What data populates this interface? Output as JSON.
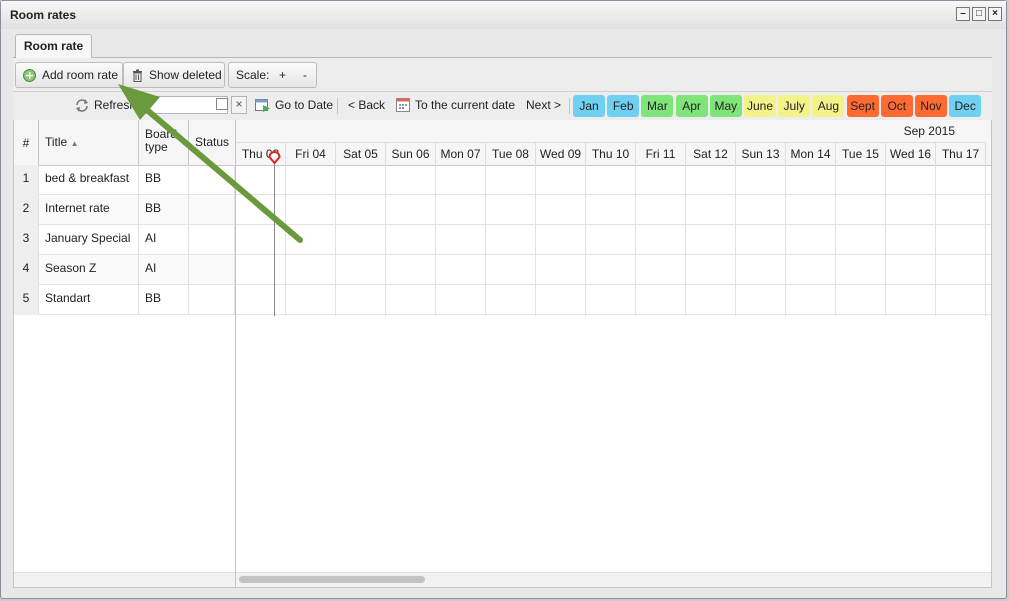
{
  "window": {
    "title": "Room rates"
  },
  "tabs": [
    {
      "label": "Room rate"
    }
  ],
  "toolbar": {
    "add_label": "Add room rate",
    "show_deleted_label": "Show deleted",
    "scale_label": "Scale:",
    "scale_plus": "+",
    "scale_minus": "-"
  },
  "nav": {
    "refresh_label": "Refresh",
    "date_value": "",
    "go_to_date_label": "Go to Date",
    "back_label": "< Back",
    "current_date_label": "To the current date",
    "next_label": "Next >"
  },
  "months": [
    {
      "label": "Jan",
      "color": "#6fd0f2"
    },
    {
      "label": "Feb",
      "color": "#6fd0f2"
    },
    {
      "label": "Mar",
      "color": "#7fe57a"
    },
    {
      "label": "Apr",
      "color": "#7fe57a"
    },
    {
      "label": "May",
      "color": "#7fe57a"
    },
    {
      "label": "June",
      "color": "#f3f38a"
    },
    {
      "label": "July",
      "color": "#f3f38a"
    },
    {
      "label": "Aug",
      "color": "#f3f38a"
    },
    {
      "label": "Sept",
      "color": "#ff6a33"
    },
    {
      "label": "Oct",
      "color": "#ff6a33"
    },
    {
      "label": "Nov",
      "color": "#ff6a33"
    },
    {
      "label": "Dec",
      "color": "#6fd0f2"
    }
  ],
  "columns": {
    "num": "#",
    "title": "Title",
    "board": "Board type",
    "status": "Status"
  },
  "rows": [
    {
      "num": "1",
      "title": "bed & breakfast",
      "board": "BB",
      "status": ""
    },
    {
      "num": "2",
      "title": "Internet rate",
      "board": "BB",
      "status": ""
    },
    {
      "num": "3",
      "title": "January Special",
      "board": "AI",
      "status": ""
    },
    {
      "num": "4",
      "title": "Season Z",
      "board": "AI",
      "status": ""
    },
    {
      "num": "5",
      "title": "Standart",
      "board": "BB",
      "status": ""
    }
  ],
  "calendar": {
    "month_label": "Sep 2015",
    "days": [
      "Thu 03",
      "Fri 04",
      "Sat 05",
      "Sun 06",
      "Mon 07",
      "Tue 08",
      "Wed 09",
      "Thu 10",
      "Fri 11",
      "Sat 12",
      "Sun 13",
      "Mon 14",
      "Tue 15",
      "Wed 16",
      "Thu 17"
    ]
  },
  "colors": {
    "arrow": "#6b9a3c",
    "today_marker": "#e02020"
  }
}
